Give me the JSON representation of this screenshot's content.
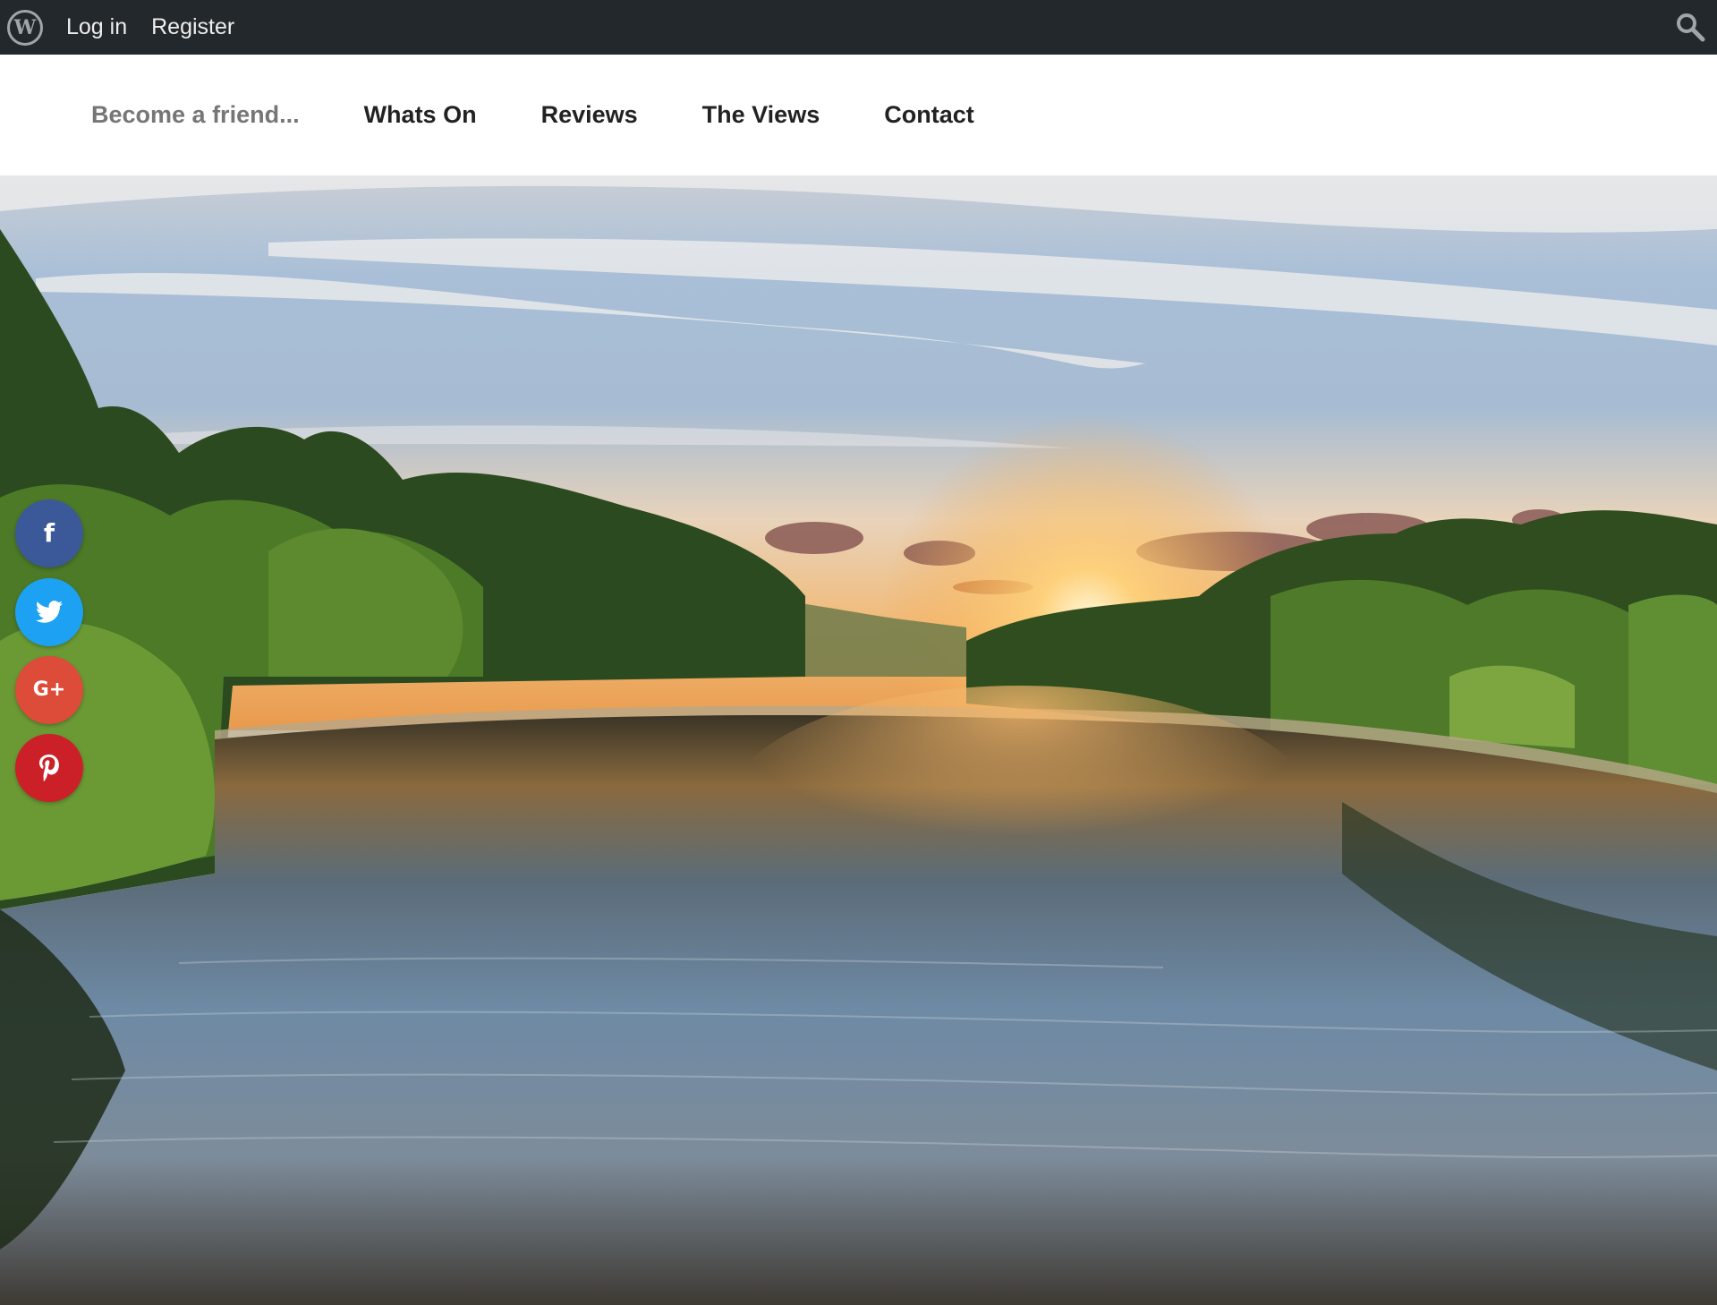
{
  "admin_bar": {
    "logo_glyph": "W",
    "login_label": "Log in",
    "register_label": "Register",
    "background_color": "#23282d"
  },
  "main_nav": {
    "items": [
      {
        "label": "Become a friend..."
      },
      {
        "label": "Whats On"
      },
      {
        "label": "Reviews"
      },
      {
        "label": "The Views"
      },
      {
        "label": "Contact"
      }
    ]
  },
  "share_bar": {
    "buttons": [
      {
        "network": "facebook",
        "glyph": "f",
        "color": "#3b5998"
      },
      {
        "network": "twitter",
        "glyph": "twitter-bird-icon",
        "color": "#1da1f2"
      },
      {
        "network": "google-plus",
        "glyph": "G+",
        "color": "#dd4b39"
      },
      {
        "network": "pinterest",
        "glyph": "P",
        "color": "#cb2027"
      }
    ]
  },
  "hero": {
    "icons": [
      "sun",
      "trees",
      "river-reflection",
      "clouds"
    ]
  }
}
